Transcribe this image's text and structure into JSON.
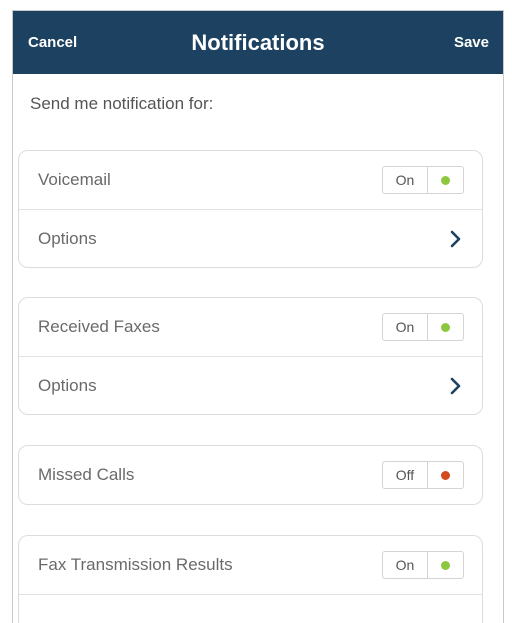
{
  "header": {
    "cancel_label": "Cancel",
    "title": "Notifications",
    "save_label": "Save"
  },
  "intro": "Send me notification for:",
  "colors": {
    "header_bg": "#1d4261",
    "on_dot": "#8dc63f",
    "off_dot": "#d2491c",
    "chevron": "#1d4261"
  },
  "cards": [
    {
      "label": "Voicemail",
      "state": "On",
      "options_label": "Options"
    },
    {
      "label": "Received Faxes",
      "state": "On",
      "options_label": "Options"
    },
    {
      "label": "Missed Calls",
      "state": "Off"
    },
    {
      "label": "Fax Transmission Results",
      "state": "On"
    }
  ]
}
